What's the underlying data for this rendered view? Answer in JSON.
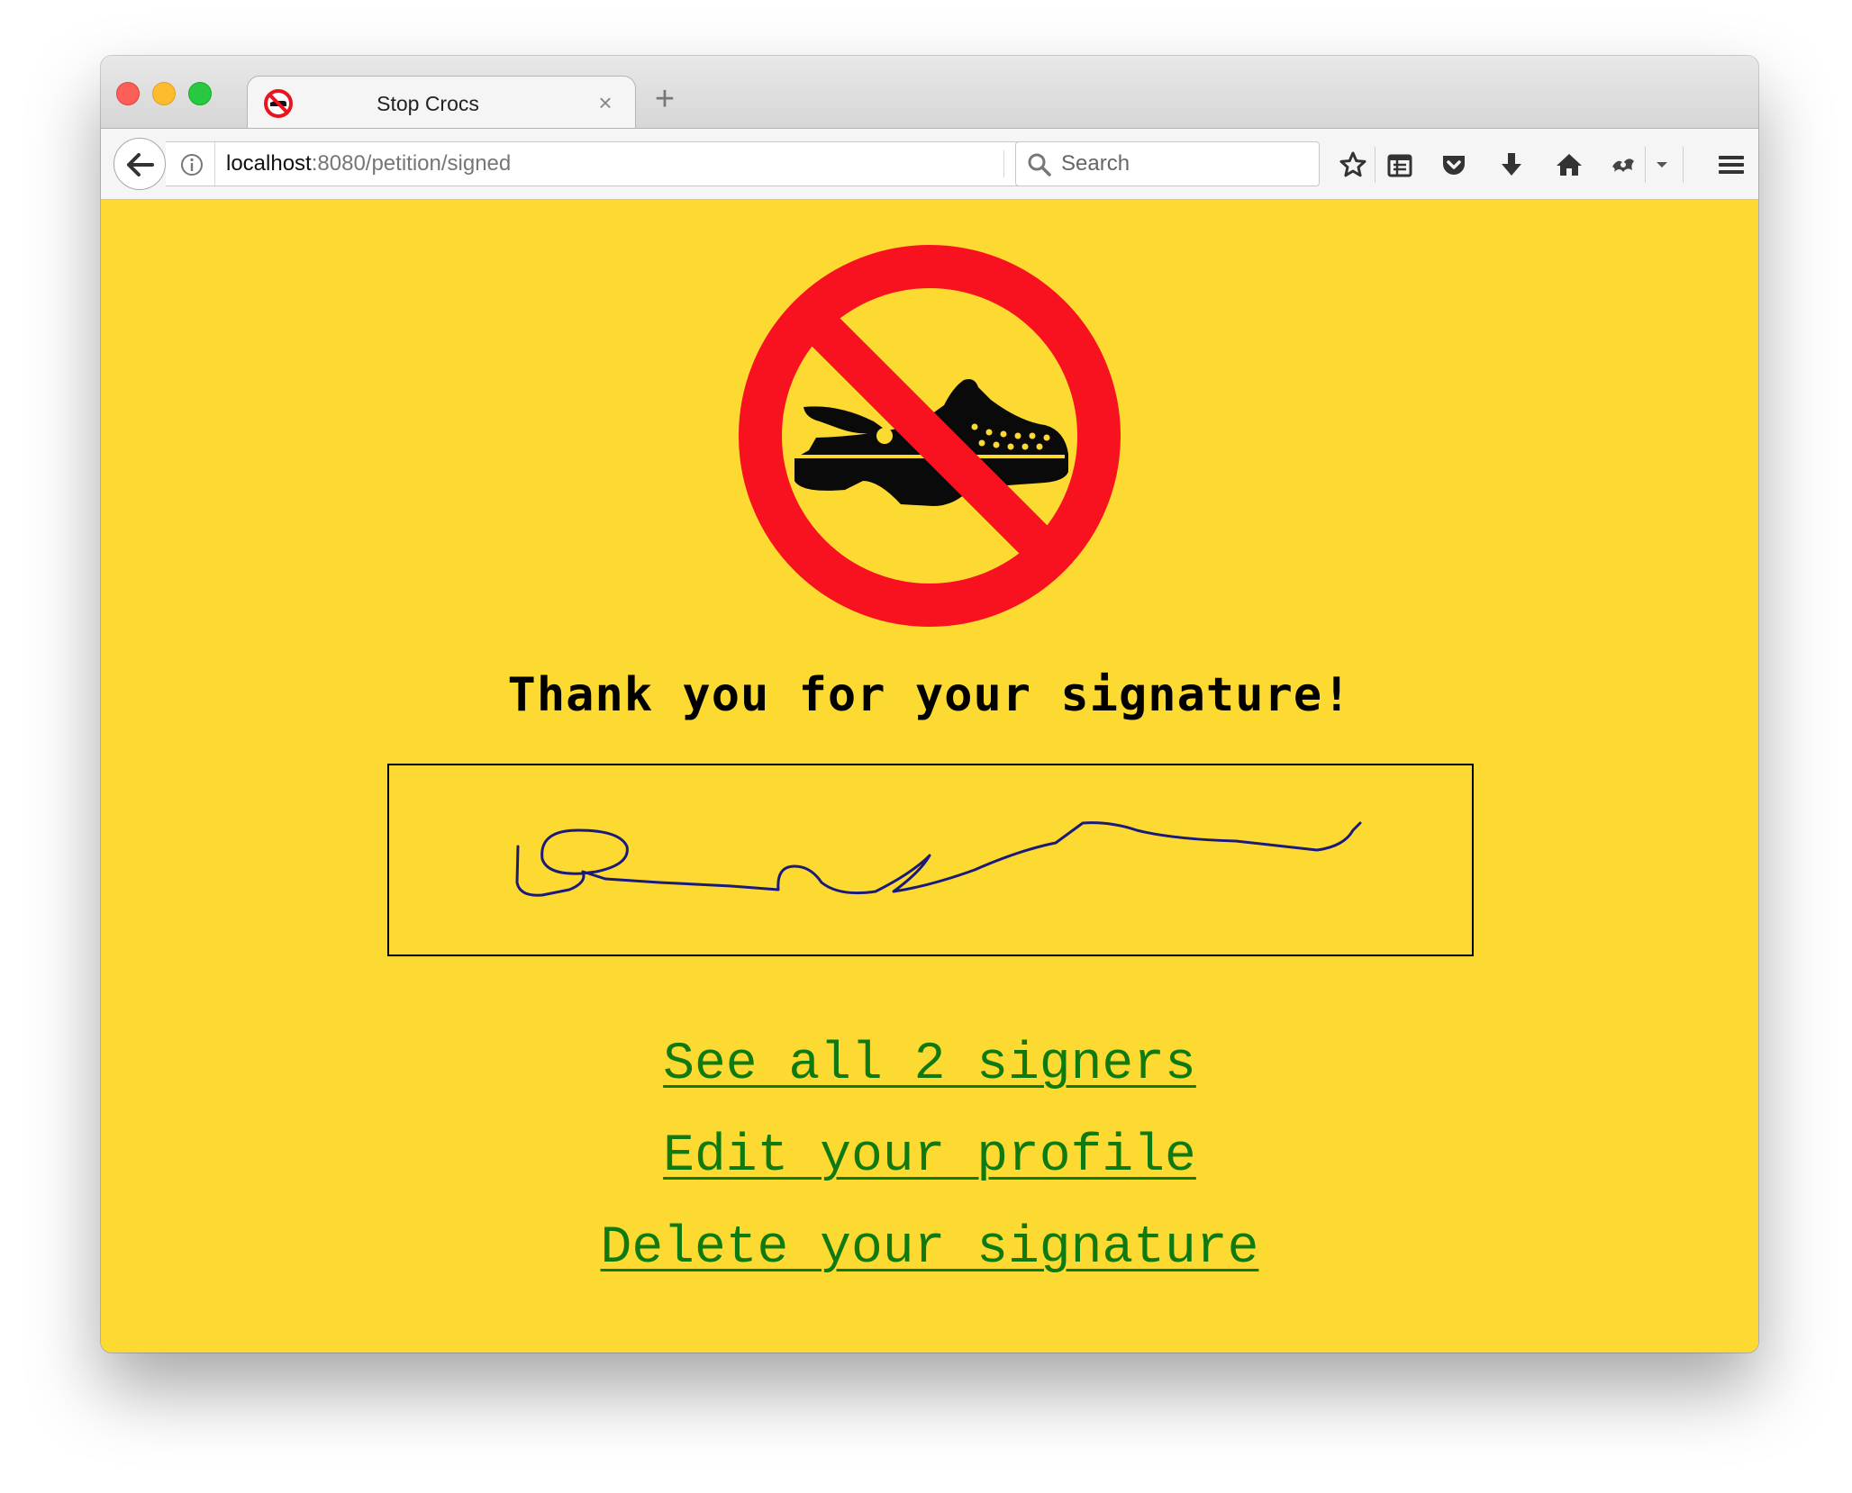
{
  "browser": {
    "tab": {
      "title": "Stop Crocs",
      "close_glyph": "×",
      "favicon": "no-crocs-icon"
    },
    "new_tab_glyph": "+",
    "url": {
      "host": "localhost",
      "rest": ":8080/petition/signed"
    },
    "search": {
      "placeholder": "Search"
    },
    "toolbar_icons": [
      "star-icon",
      "reading-list-icon",
      "pocket-icon",
      "download-icon",
      "home-icon",
      "extension-icon",
      "dropdown-icon",
      "hamburger-menu-icon"
    ]
  },
  "page": {
    "background_color": "#fdda31",
    "link_color": "#0f7a10",
    "logo": "no-crocs-icon",
    "heading": "Thank you for your signature!",
    "signature_color": "#1a1a7a",
    "links": {
      "see_signers": "See all 2 signers",
      "edit_profile": "Edit your profile",
      "delete_signature": "Delete your signature"
    }
  }
}
